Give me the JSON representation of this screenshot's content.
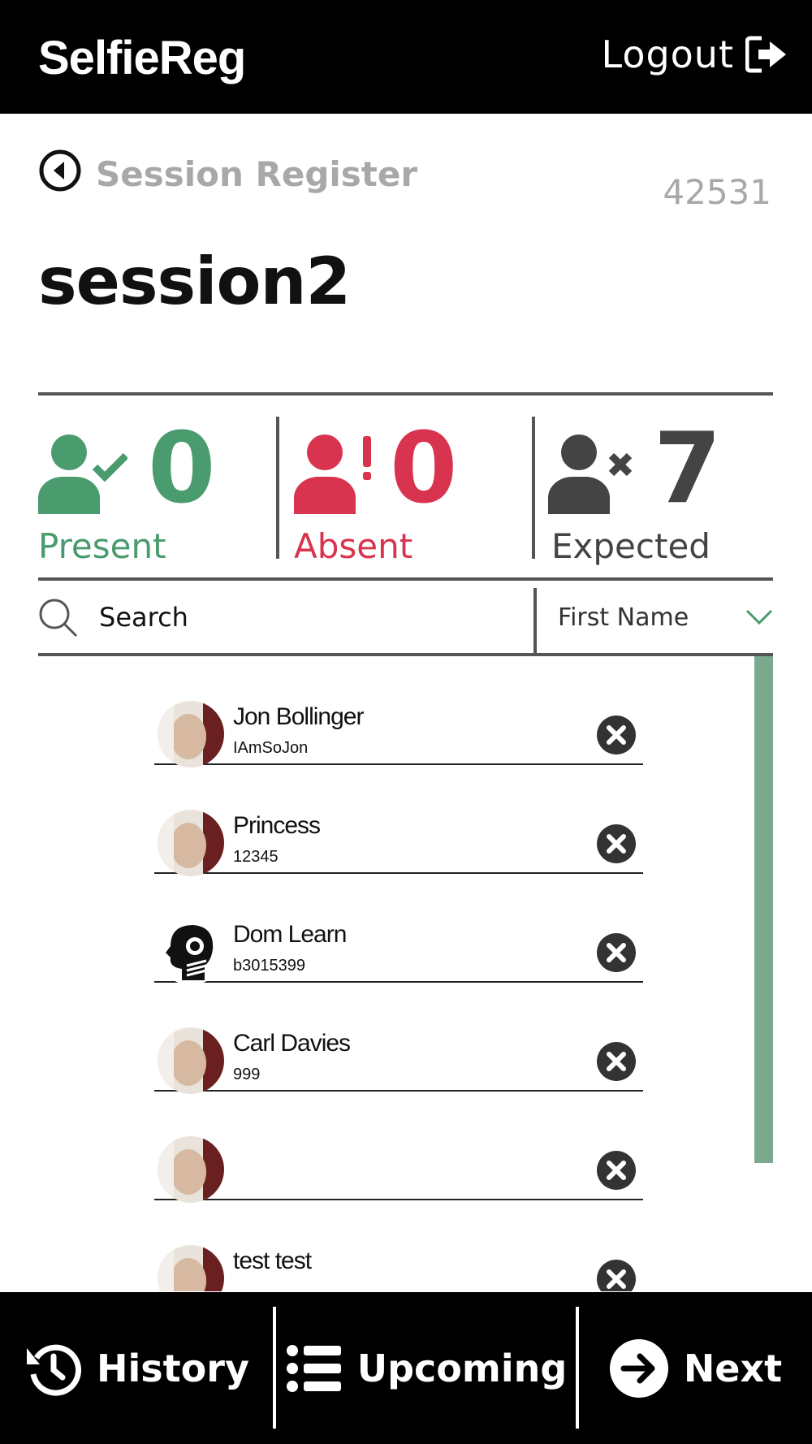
{
  "header": {
    "brand": "SelfieReg",
    "logout_label": "Logout"
  },
  "page": {
    "section_label": "Session Register",
    "session_id": "42531",
    "session_title": "session2"
  },
  "stats": {
    "present": {
      "count": "0",
      "label": "Present",
      "color": "#4a9b6e"
    },
    "absent": {
      "count": "0",
      "label": "Absent",
      "color": "#d9344f"
    },
    "expected": {
      "count": "7",
      "label": "Expected",
      "color": "#444444"
    }
  },
  "search": {
    "placeholder": "Search",
    "sort_selected": "First Name"
  },
  "students": [
    {
      "name": "Jon Bollinger",
      "id": "IAmSoJon",
      "avatar": "photo"
    },
    {
      "name": "Princess",
      "id": "12345",
      "avatar": "photo"
    },
    {
      "name": "Dom Learn",
      "id": "b3015399",
      "avatar": "head-silhouette"
    },
    {
      "name": "Carl Davies",
      "id": "999",
      "avatar": "photo"
    },
    {
      "name": "",
      "id": "",
      "avatar": "photo"
    },
    {
      "name": "test test",
      "id": "",
      "avatar": "photo"
    }
  ],
  "nav": {
    "history": "History",
    "upcoming": "Upcoming",
    "next": "Next"
  },
  "colors": {
    "accent_scrollbar": "#7aa98e",
    "bar_background": "#000000"
  }
}
